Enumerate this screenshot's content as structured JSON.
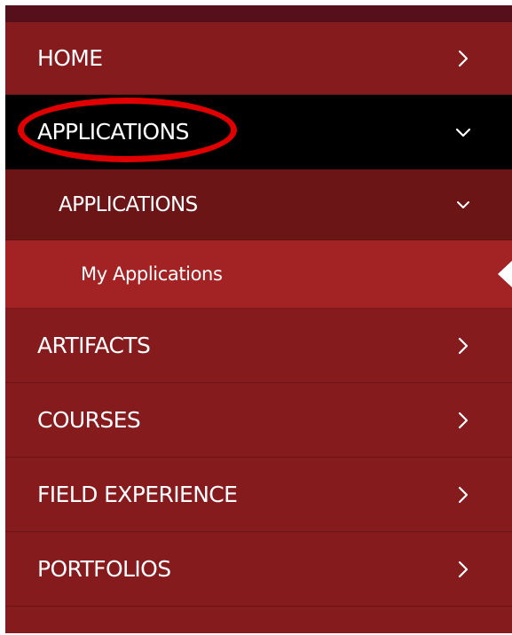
{
  "colors": {
    "menu_bg": "#861b1e",
    "top_strip": "#55101b",
    "active_bg": "#000000",
    "submenu_bg": "#6b1517",
    "selected_leaf_bg": "#a32224",
    "text": "#ffffff",
    "annotation": "#e00000"
  },
  "nav": {
    "items": [
      {
        "label": "HOME",
        "icon": "chevron-right-icon",
        "state": "collapsed"
      },
      {
        "label": "APPLICATIONS",
        "icon": "chevron-down-icon",
        "state": "expanded",
        "active": true
      },
      {
        "label": "APPLICATIONS",
        "icon": "chevron-down-icon",
        "state": "expanded",
        "level": 2
      },
      {
        "label": "My Applications",
        "level": 3,
        "selected": true
      },
      {
        "label": "ARTIFACTS",
        "icon": "chevron-right-icon",
        "state": "collapsed"
      },
      {
        "label": "COURSES",
        "icon": "chevron-right-icon",
        "state": "collapsed"
      },
      {
        "label": "FIELD EXPERIENCE",
        "icon": "chevron-right-icon",
        "state": "collapsed"
      },
      {
        "label": "PORTFOLIOS",
        "icon": "chevron-right-icon",
        "state": "collapsed"
      }
    ]
  }
}
